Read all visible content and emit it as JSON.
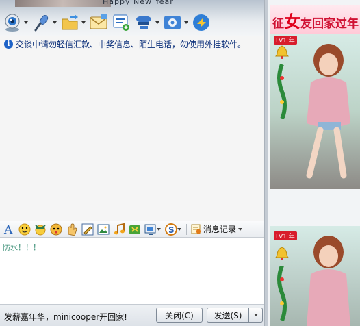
{
  "header": {
    "title": "Happy New Year"
  },
  "toolbar": [
    {
      "name": "video-chat-button",
      "icon": "webcam-icon",
      "has_menu": true
    },
    {
      "name": "voice-chat-button",
      "icon": "microphone-icon",
      "has_menu": true
    },
    {
      "name": "send-file-button",
      "icon": "folder-transfer-icon",
      "has_menu": true
    },
    {
      "name": "send-email-button",
      "icon": "envelope-icon",
      "has_menu": false
    },
    {
      "name": "sms-button",
      "icon": "message-icon",
      "has_menu": false
    },
    {
      "name": "invite-group-button",
      "icon": "group-icon",
      "has_menu": true
    },
    {
      "name": "apps-button",
      "icon": "settings-app-icon",
      "has_menu": true
    },
    {
      "name": "remote-assist-button",
      "icon": "remote-icon",
      "has_menu": false
    }
  ],
  "chat": {
    "notice": "交谈中请勿轻信汇款、中奖信息、陌生电话，勿使用外挂软件。"
  },
  "formatbar": {
    "history_label": "消息记录",
    "icons": [
      "font-icon",
      "smiley-icon",
      "cool-face-icon",
      "magic-face-icon",
      "shake-window-icon",
      "handwriting-icon",
      "image-icon",
      "music-icon",
      "game-icon",
      "screenshot-icon",
      "search-icon"
    ]
  },
  "input": {
    "text": "防水！！！"
  },
  "bottombar": {
    "promo": "发薪嘉年华，minicooper开回家!",
    "close_label": "关闭(C)",
    "send_label": "发送(S)"
  },
  "ads": {
    "banner_text_prefix": "征",
    "banner_text_highlight": "女",
    "banner_text_suffix": "友回家过年",
    "tag": "LV1 年"
  },
  "colors": {
    "notice_text": "#0b2f7a",
    "input_text": "#3b8f76",
    "ad_banner": "#d01133"
  }
}
